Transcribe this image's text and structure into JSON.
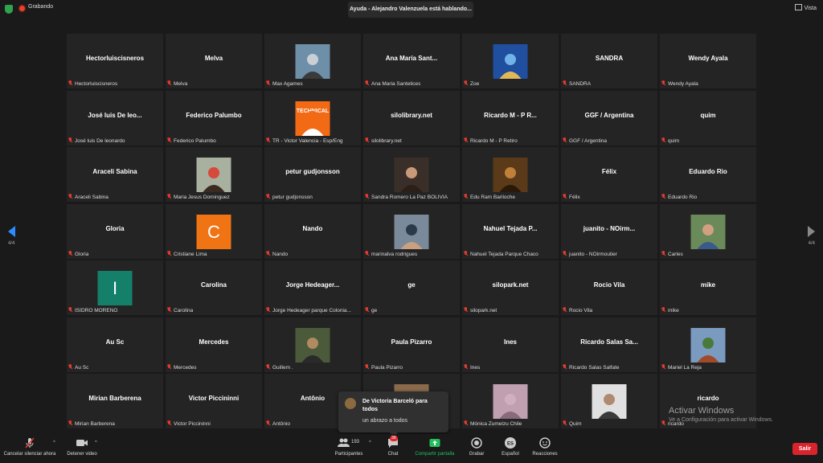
{
  "topbar": {
    "recording": "Grabando",
    "speaker": "Ayuda - Alejandro Valenzuela está hablando...",
    "view": "Vista"
  },
  "nav": {
    "page_left": "4/4",
    "page_right": "4/4"
  },
  "tiles": [
    {
      "center": "Hectorluiscisneros",
      "label": "Hectorluiscisneros"
    },
    {
      "center": "Melva",
      "label": "Melva"
    },
    {
      "center": "",
      "label": "Max Agames",
      "photo": "man-with-harbor"
    },
    {
      "center": "Ana María Sant...",
      "label": "Ana Maria Santelices"
    },
    {
      "center": "",
      "label": "Zoe",
      "photo": "blue-meditation-graphic"
    },
    {
      "center": "SANDRA",
      "label": "SANDRA"
    },
    {
      "center": "Wendy Ayala",
      "label": "Wendy Ayala"
    },
    {
      "center": "José luis De leo...",
      "label": "José luis De leonardo"
    },
    {
      "center": "Federico Palumbo",
      "label": "Federico Palumbo"
    },
    {
      "center": "",
      "label": "TR - Victor Valencia - Esp/Eng",
      "photo": "technical-support-logo",
      "photo_text": "TECHNICAL"
    },
    {
      "center": "silolibrary.net",
      "label": "silolibrary.net"
    },
    {
      "center": "Ricardo M - P R...",
      "label": "Ricardo M - P Retiro"
    },
    {
      "center": "GGF / Argentina",
      "label": "GGF / Argentina"
    },
    {
      "center": "quim",
      "label": "quim"
    },
    {
      "center": "Araceli Sabina",
      "label": "Araceli Sabina"
    },
    {
      "center": "",
      "label": "Maria Jesus Dominguez",
      "photo": "person-red-scarf"
    },
    {
      "center": "petur gudjonsson",
      "label": "petur gudjonsson"
    },
    {
      "center": "",
      "label": "Sandra Romero La Paz BOLIVIA",
      "photo": "woman-portrait"
    },
    {
      "center": "",
      "label": "Edu Ram Bariloche",
      "photo": "temple-corridor"
    },
    {
      "center": "Félix",
      "label": "Félix"
    },
    {
      "center": "Eduardo Rio",
      "label": "Eduardo Rio"
    },
    {
      "center": "Gloria",
      "label": "Gloria"
    },
    {
      "center": "",
      "label": "Cristiane Lima",
      "letter": "C",
      "letter_color": "#f07314"
    },
    {
      "center": "Nando",
      "label": "Nando"
    },
    {
      "center": "",
      "label": "marinalva rodrigues",
      "photo": "man-mask"
    },
    {
      "center": "Nahuel Tejada P...",
      "label": "Nahuel Tejada Parque Chaco"
    },
    {
      "center": "juanito - NOirm...",
      "label": "juanito - NOirmoutier"
    },
    {
      "center": "",
      "label": "Carles",
      "photo": "man-outdoors"
    },
    {
      "center": "",
      "label": "ISIDRO MORENO",
      "letter": "I",
      "letter_color": "#14806a"
    },
    {
      "center": "Carolina",
      "label": "Carolina"
    },
    {
      "center": "Jorge Hedeager...",
      "label": "Jorge Hedeager parque Colonia..."
    },
    {
      "center": "ge",
      "label": "ge"
    },
    {
      "center": "silopark.net",
      "label": "silopark.net"
    },
    {
      "center": "Rocio Vila",
      "label": "Rocio Vila"
    },
    {
      "center": "mike",
      "label": "mike"
    },
    {
      "center": "Au Sc",
      "label": "Au Sc"
    },
    {
      "center": "Mercedes",
      "label": "Mercedes"
    },
    {
      "center": "",
      "label": "Guillem .",
      "photo": "man-glasses"
    },
    {
      "center": "Paula Pizarro",
      "label": "Paula Pizarro"
    },
    {
      "center": "Ines",
      "label": "Ines"
    },
    {
      "center": "Ricardo Salas Sa...",
      "label": "Ricardo Salas Salfate"
    },
    {
      "center": "",
      "label": "Mariel La Reja",
      "photo": "park-landscape"
    },
    {
      "center": "Mirian Barberena",
      "label": "Mirian Barberena"
    },
    {
      "center": "Victor Piccininni",
      "label": "Victor Piccininni"
    },
    {
      "center": "Antônio",
      "label": "Antônio"
    },
    {
      "center": "",
      "label": "",
      "photo": "partial-hidden"
    },
    {
      "center": "",
      "label": "Mónica Zumelzu Chile",
      "photo": "woman-pink"
    },
    {
      "center": "",
      "label": "Quim",
      "photo": "man-video"
    },
    {
      "center": "ricardo",
      "label": "ricardo"
    }
  ],
  "chat_popup": {
    "title": "De Victoria Barceló para todos",
    "message": "un abrazo a todos"
  },
  "watermark": {
    "title": "Activar Windows",
    "subtitle": "Ve a Configuración para activar Windows."
  },
  "toolbar": {
    "mute": "Cancelar silenciar ahora",
    "video": "Detener video",
    "participants": "Participantes",
    "participants_count": "193",
    "chat": "Chat",
    "chat_badge": "39",
    "share": "Compartir pantalla",
    "record": "Grabar",
    "spanish": "Español",
    "spanish_icon_text": "ES",
    "reactions": "Reacciones",
    "exit": "Salir"
  },
  "colors": {
    "accent": "#2d8cff",
    "share": "#22c05d",
    "exit": "#d9232d",
    "muted": "#e03a2f"
  }
}
